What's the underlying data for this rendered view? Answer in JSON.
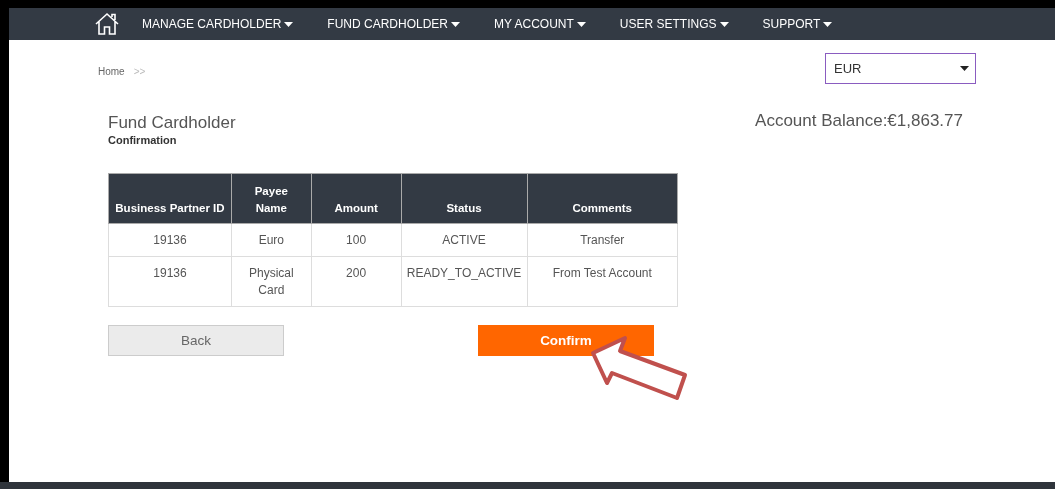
{
  "nav": {
    "items": [
      {
        "label": "MANAGE CARDHOLDER"
      },
      {
        "label": "FUND CARDHOLDER"
      },
      {
        "label": "MY ACCOUNT"
      },
      {
        "label": "USER SETTINGS"
      },
      {
        "label": "SUPPORT"
      }
    ]
  },
  "breadcrumb": [
    "Home",
    ">>"
  ],
  "currency_select": {
    "value": "EUR"
  },
  "page": {
    "title": "Fund Cardholder",
    "subtitle": "Confirmation",
    "balance": "Account Balance:€1,863.77"
  },
  "table": {
    "columns": [
      "Business Partner ID",
      "Payee Name",
      "Amount",
      "Status",
      "Comments"
    ],
    "rows": [
      [
        "19136",
        "Euro",
        "100",
        "ACTIVE",
        "Transfer"
      ],
      [
        "19136",
        "Physical Card",
        "200",
        "READY_TO_ACTIVE",
        "From Test Account"
      ]
    ]
  },
  "buttons": [
    {
      "label": "Back",
      "kind": "secondary"
    },
    {
      "label": "Confirm",
      "kind": "primary"
    }
  ]
}
